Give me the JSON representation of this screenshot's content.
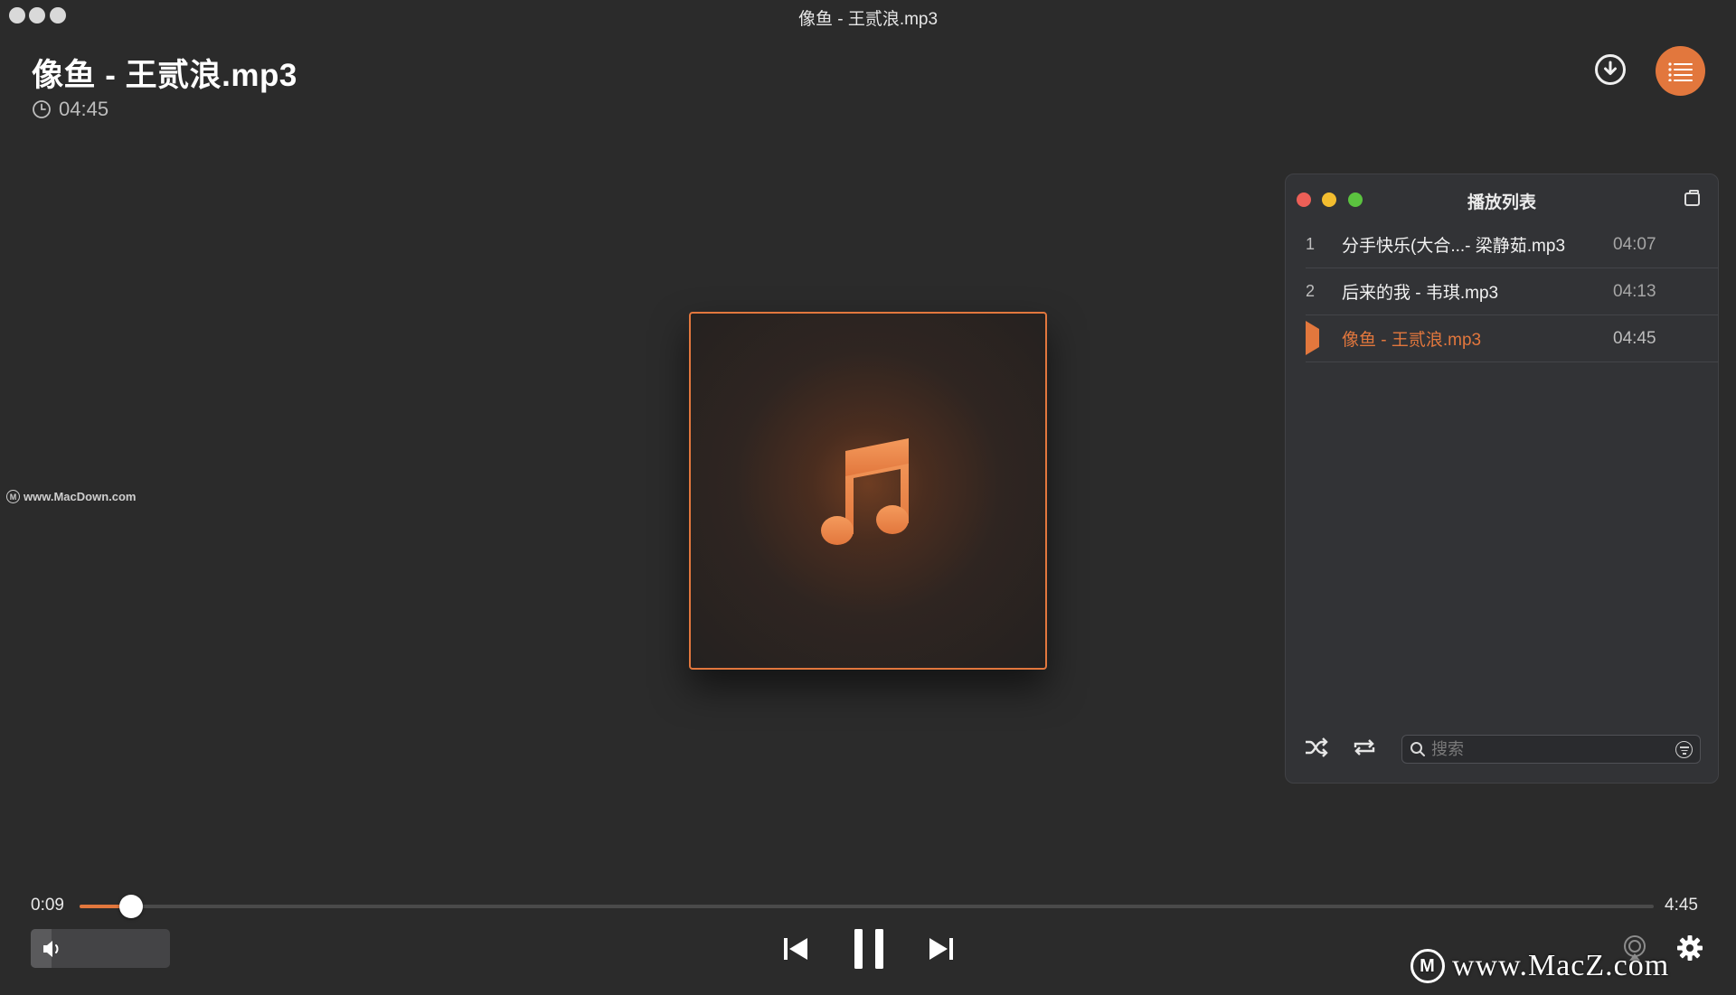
{
  "window": {
    "title": "像鱼 - 王贰浪.mp3"
  },
  "header": {
    "song_title": "像鱼 - 王贰浪.mp3",
    "duration": "04:45"
  },
  "watermark_left": "www.MacDown.com",
  "watermark_right": "www.MacZ.com",
  "playlist": {
    "title": "播放列表",
    "tracks": [
      {
        "num": "1",
        "name": "分手快乐(大合...- 梁静茹.mp3",
        "time": "04:07",
        "active": false
      },
      {
        "num": "2",
        "name": "后来的我 - 韦琪.mp3",
        "time": "04:13",
        "active": false
      },
      {
        "num": "",
        "name": "像鱼 - 王贰浪.mp3",
        "time": "04:45",
        "active": true
      }
    ],
    "search_placeholder": "搜索"
  },
  "player": {
    "current_time": "0:09",
    "total_time": "4:45",
    "progress_fraction": 0.033,
    "volume_fraction": 0.15
  },
  "colors": {
    "accent": "#e2773d",
    "background": "#2b2b2b",
    "panel": "#323336"
  },
  "icons": [
    "clock-icon",
    "download-icon",
    "playlist-icon",
    "shuffle-icon",
    "repeat-icon",
    "search-icon",
    "filter-icon",
    "volume-icon",
    "previous-icon",
    "pause-icon",
    "next-icon",
    "airplay-icon",
    "gear-icon",
    "music-note-icon"
  ]
}
